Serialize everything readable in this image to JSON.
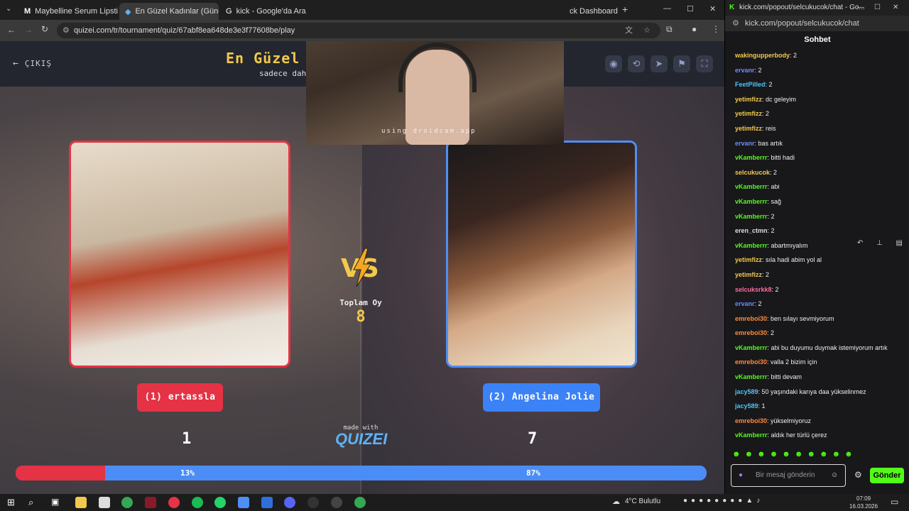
{
  "browser": {
    "tabs": [
      {
        "label": "Maybelline Serum Lipstick"
      },
      {
        "label": "En Güzel Kadınlar (Güncell"
      },
      {
        "label": "kick - Google'da Ara"
      },
      {
        "label": "ck Dashboard"
      }
    ],
    "url": "quizei.com/tr/tournament/quiz/67abf8ea648de3e3f77608be/play"
  },
  "quiz": {
    "exit_label": "ÇIKIŞ",
    "title": "En Güzel",
    "subtitle": "sadece dah",
    "cam_text": "using droidcam.app",
    "contestant_a": {
      "name": "(1) ertassla",
      "votes": "1",
      "percent": "13%",
      "share": 0.13,
      "color": "#e53245"
    },
    "contestant_b": {
      "name": "(2) Angelina Jolie",
      "votes": "7",
      "percent": "87%",
      "share": 0.87,
      "color": "#3b82f6"
    },
    "vs_label": "VS",
    "total_label": "Toplam Oy",
    "total_value": "8",
    "made_with": "made with",
    "brand": "QUIZEI"
  },
  "chat": {
    "window_title": "kick.com/popout/selcukucok/chat - Go...",
    "url": "kick.com/popout/selcukucok/chat",
    "header": "Sohbet",
    "messages": [
      {
        "user": "wakingupperbody",
        "text": ": 2",
        "color": "#f2c94c"
      },
      {
        "user": "ervanr",
        "text": ": 2",
        "color": "#6b8cff"
      },
      {
        "user": "FeetPilled",
        "text": ": 2",
        "color": "#4fc3f7"
      },
      {
        "user": "yetimfizz",
        "text": ": dc geleyim",
        "color": "#f2c94c"
      },
      {
        "user": "yetimfizz",
        "text": ": 2",
        "color": "#f2c94c"
      },
      {
        "user": "yetimfizz",
        "text": ": reis",
        "color": "#f2c94c"
      },
      {
        "user": "ervanr",
        "text": ": bas artık",
        "color": "#6b8cff"
      },
      {
        "user": "vKamberrr",
        "text": ": bitti hadi",
        "color": "#53fc18"
      },
      {
        "user": "selcukucok",
        "text": ": 2",
        "color": "#f2c94c"
      },
      {
        "user": "vKamberrr",
        "text": ": abi",
        "color": "#53fc18"
      },
      {
        "user": "vKamberrr",
        "text": ": sağ",
        "color": "#53fc18"
      },
      {
        "user": "vKamberrr",
        "text": ": 2",
        "color": "#53fc18"
      },
      {
        "user": "eren_ctmn",
        "text": ": 2",
        "color": "#dddddd"
      },
      {
        "user": "vKamberrr",
        "text": ": abartmıyalım",
        "color": "#53fc18"
      },
      {
        "user": "yetimfizz",
        "text": ": sıla hadi abim yol al",
        "color": "#f2c94c"
      },
      {
        "user": "yetimfizz",
        "text": ": 2",
        "color": "#f2c94c"
      },
      {
        "user": "selcuksrkk8",
        "text": ": 2",
        "color": "#ff6b9d"
      },
      {
        "user": "ervanr",
        "text": ": 2",
        "color": "#6b8cff"
      },
      {
        "user": "emreboi30",
        "text": ": ben sılayı sevmiyorum",
        "color": "#ff8a3d"
      },
      {
        "user": "emreboi30",
        "text": ": 2",
        "color": "#ff8a3d"
      },
      {
        "user": "vKamberrr",
        "text": ": abi bu duyumu duymak istemiyorum artık",
        "color": "#53fc18"
      },
      {
        "user": "emreboi30",
        "text": ": valla 2 bizim için",
        "color": "#ff8a3d"
      },
      {
        "user": "vKamberrr",
        "text": ": bitti devam",
        "color": "#53fc18"
      },
      {
        "user": "jacy589",
        "text": ": 50 yaşındaki karıya daa yükselinmez",
        "color": "#4fc3f7"
      },
      {
        "user": "jacy589",
        "text": ": 1",
        "color": "#4fc3f7"
      },
      {
        "user": "emreboi30",
        "text": ": yükselmiyoruz",
        "color": "#ff8a3d"
      },
      {
        "user": "vKamberrr",
        "text": ": aldık her türlü çerez",
        "color": "#53fc18"
      }
    ],
    "input_placeholder": "Bir mesaj gönderin",
    "send_label": "Gönder"
  },
  "taskbar": {
    "weather": "4°C Bulutlu",
    "time": "07:09",
    "date": "16.03.2026"
  }
}
